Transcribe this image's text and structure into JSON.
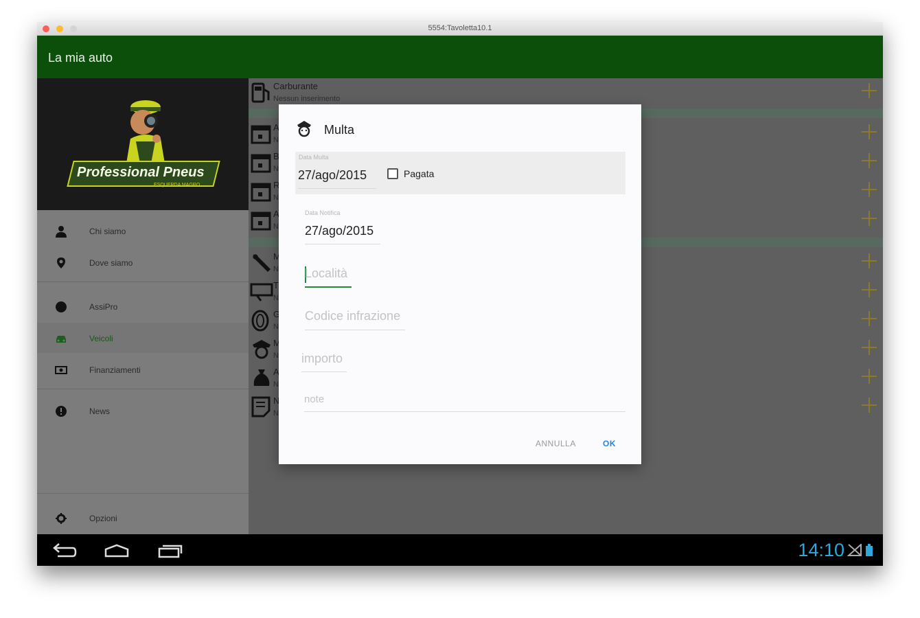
{
  "window": {
    "title": "5554:Tavoletta10.1"
  },
  "actionbar": {
    "title": "La mia auto"
  },
  "drawer": {
    "logo_text": "Professional Pneus",
    "logo_subtext": "ESQUERDA MAGRO",
    "items": [
      {
        "label": "Chi siamo",
        "icon": "person-icon"
      },
      {
        "label": "Dove siamo",
        "icon": "location-pin-icon"
      },
      {
        "label": "AssiPro",
        "icon": "circle-icon"
      },
      {
        "label": "Veicoli",
        "icon": "car-icon",
        "selected": true
      },
      {
        "label": "Finanziamenti",
        "icon": "money-icon"
      },
      {
        "label": "News",
        "icon": "info-icon"
      },
      {
        "label": "Opzioni",
        "icon": "gear-icon"
      }
    ]
  },
  "content": {
    "rows": [
      {
        "title": "Carburante",
        "subtitle": "Nessun inserimento",
        "icon": "fuel-pump-icon"
      },
      {
        "title": "A",
        "subtitle": "N",
        "icon": "calendar-icon"
      },
      {
        "title": "B",
        "subtitle": "N",
        "icon": "calendar-icon"
      },
      {
        "title": "R",
        "subtitle": "N",
        "icon": "calendar-icon"
      },
      {
        "title": "A",
        "subtitle": "N",
        "icon": "calendar-icon"
      },
      {
        "title": "M",
        "subtitle": "N",
        "icon": "wrench-icon"
      },
      {
        "title": "T",
        "subtitle": "N",
        "icon": "ticket-icon"
      },
      {
        "title": "G",
        "subtitle": "N",
        "icon": "tire-icon"
      },
      {
        "title": "M",
        "subtitle": "N",
        "icon": "police-icon"
      },
      {
        "title": "A",
        "subtitle": "N",
        "icon": "money-bag-icon"
      },
      {
        "title": "N",
        "subtitle": "N",
        "icon": "note-icon"
      }
    ]
  },
  "dialog": {
    "title": "Multa",
    "icon": "police-officer-icon",
    "data_multa_label": "Data Multa",
    "data_multa_value": "27/ago/2015",
    "pagata_label": "Pagata",
    "pagata_checked": false,
    "data_notifica_label": "Data Notifica",
    "data_notifica_value": "27/ago/2015",
    "localita_placeholder": "Località",
    "codice_placeholder": "Codice infrazione",
    "importo_placeholder": "importo",
    "note_placeholder": "note",
    "cancel_label": "ANNULLA",
    "ok_label": "OK"
  },
  "navbar": {
    "clock": "14:10"
  },
  "colors": {
    "actionbar": "#0b4f0b",
    "accent": "#2ea7db",
    "plus": "#8c7a2a",
    "ok": "#1e88e5"
  }
}
